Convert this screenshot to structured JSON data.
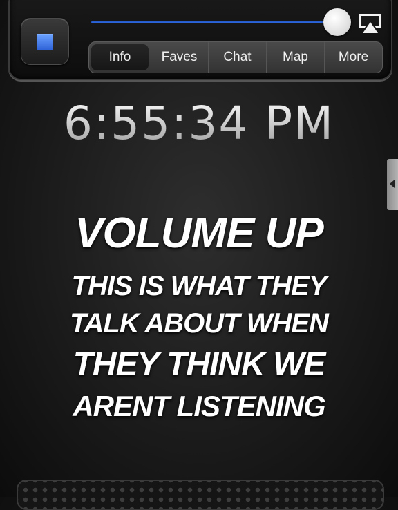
{
  "player": {
    "stop_icon": "stop-square-icon",
    "volume_level": 0.96,
    "airplay_icon": "airplay-icon"
  },
  "tabs": [
    {
      "label": "Info",
      "active": true
    },
    {
      "label": "Faves",
      "active": false
    },
    {
      "label": "Chat",
      "active": false
    },
    {
      "label": "Map",
      "active": false
    },
    {
      "label": "More",
      "active": false
    }
  ],
  "clock": "6:55:34 PM",
  "side_tab_icon": "triangle-left-icon",
  "caption": {
    "line1": "VOLUME UP",
    "line2": "THIS IS WHAT THEY",
    "line3": "TALK ABOUT WHEN",
    "line4": "THEY THINK WE",
    "line5": "ARENT LISTENING"
  },
  "colors": {
    "accent": "#2b63d9",
    "stop_button": "#3f7ff0",
    "text": "#ffffff"
  }
}
